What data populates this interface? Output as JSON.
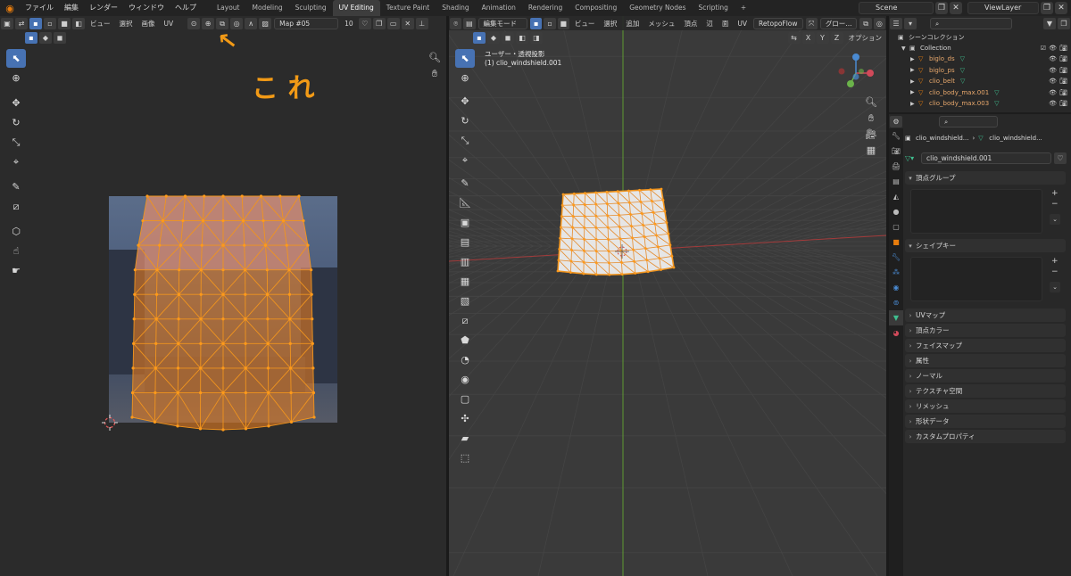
{
  "topbar": {
    "menus": [
      "ファイル",
      "編集",
      "レンダー",
      "ウィンドウ",
      "ヘルプ"
    ],
    "workspaces": [
      "Layout",
      "Modeling",
      "Sculpting",
      "UV Editing",
      "Texture Paint",
      "Shading",
      "Animation",
      "Rendering",
      "Compositing",
      "Geometry Nodes",
      "Scripting"
    ],
    "active_workspace": "UV Editing",
    "add_tab": "+",
    "scene": "Scene",
    "view_layer": "ViewLayer"
  },
  "uv_editor": {
    "header_menus": [
      "ビュー",
      "選択",
      "画像",
      "UV"
    ],
    "image_name": "Map #05",
    "image_users": "10",
    "annotation": "こ れ",
    "arrow": "↖"
  },
  "viewport": {
    "mode": "編集モード",
    "header_menus": [
      "ビュー",
      "選択",
      "追加",
      "メッシュ",
      "頂点",
      "辺",
      "面",
      "UV"
    ],
    "retopoflow": "RetopoFlow",
    "orientation": "グロー...",
    "axes": [
      "X",
      "Y",
      "Z"
    ],
    "options": "オプション",
    "view_name": "ユーザー・透視投影",
    "object_name": "(1) clio_windshield.001"
  },
  "outliner": {
    "search_placeholder": "",
    "scene_collection": "シーンコレクション",
    "collection": "Collection",
    "items": [
      {
        "name": "biglo_ds"
      },
      {
        "name": "biglo_ps"
      },
      {
        "name": "clio_belt"
      },
      {
        "name": "clio_body_max.001"
      },
      {
        "name": "clio_body_max.003"
      }
    ]
  },
  "properties": {
    "breadcrumb_object": "clio_windshield...",
    "breadcrumb_mesh": "clio_windshield...",
    "mesh_name": "clio_windshield.001",
    "panels": {
      "vertex_groups": "頂点グループ",
      "shape_keys": "シェイプキー",
      "collapsed": [
        "UVマップ",
        "頂点カラー",
        "フェイスマップ",
        "属性",
        "ノーマル",
        "テクスチャ空間",
        "リメッシュ",
        "形状データ",
        "カスタムプロパティ"
      ]
    }
  },
  "colors": {
    "accent": "#4772b3",
    "orange": "#e87d0d",
    "annotation": "#f29a16",
    "mesh_icon": "#3fbf8f"
  }
}
